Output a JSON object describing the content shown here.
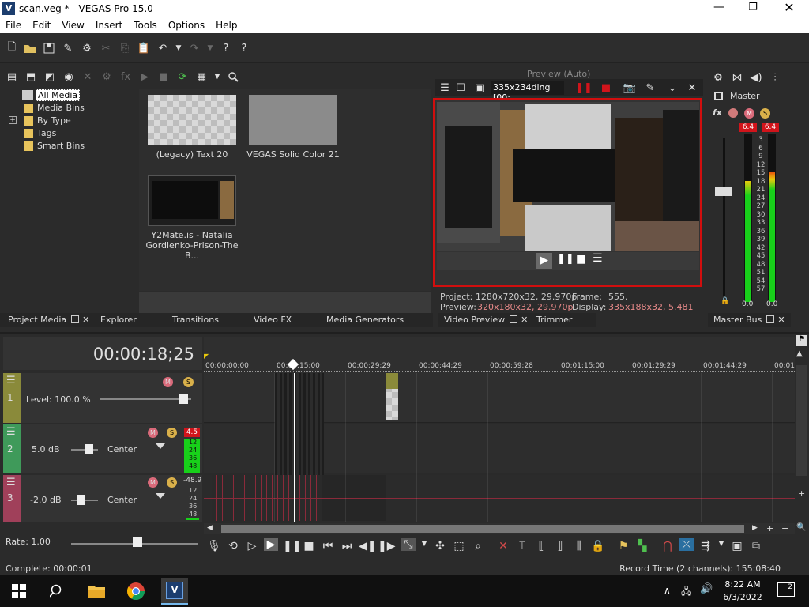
{
  "window": {
    "title": "scan.veg * - VEGAS Pro 15.0",
    "app_icon": "V"
  },
  "menu": [
    "File",
    "Edit",
    "View",
    "Insert",
    "Tools",
    "Options",
    "Help"
  ],
  "project_media": {
    "tree": [
      "All Media",
      "Media Bins",
      "By Type",
      "Tags",
      "Smart Bins"
    ],
    "items": [
      {
        "label": "(Legacy) Text 20"
      },
      {
        "label": "VEGAS Solid Color 21"
      },
      {
        "label": "Y2Mate.is - Natalia Gordienko-Prison-The B..."
      }
    ]
  },
  "bottom_tabs": [
    "Project Media",
    "Explorer",
    "Transitions",
    "Video FX",
    "Media Generators"
  ],
  "preview": {
    "toolbar_text": "Preview (Auto)",
    "position_field": "335x234ding [00:",
    "project_info": "Project:  1280x720x32, 29.970p",
    "frame_label": "Frame:",
    "frame_value": "555.",
    "preview_label": "Preview:",
    "preview_value": "320x180x32, 29.970p",
    "display_label": "Display:",
    "display_value": "335x188x32, 5.481"
  },
  "preview_tabs": [
    "Video Preview",
    "Trimmer"
  ],
  "master": {
    "title": "Master",
    "peak_left": "6.4",
    "peak_right": "6.4",
    "scale": [
      "3",
      "6",
      "9",
      "12",
      "15",
      "18",
      "21",
      "24",
      "27",
      "30",
      "33",
      "36",
      "39",
      "42",
      "45",
      "48",
      "51",
      "54",
      "57"
    ],
    "bottom_left": "0.0",
    "bottom_right": "0.0",
    "tab": "Master Bus",
    "left_level": 0.72,
    "right_level": 0.72
  },
  "timeline": {
    "timecode": "00:00:18;25",
    "ruler": [
      "00:00:00;00",
      "00:00:15;00",
      "00:00:29;29",
      "00:00:44;29",
      "00:00:59;28",
      "00:01:15;00",
      "00:01:29;29",
      "00:01:44;29",
      "00:01"
    ],
    "tracks": [
      {
        "num": "1",
        "level_label": "Level: 100.0 %"
      },
      {
        "num": "2",
        "volume": "5.0 dB",
        "pan": "Center",
        "peak": "4.5",
        "scale": [
          "12",
          "24",
          "36",
          "48"
        ]
      },
      {
        "num": "3",
        "volume": "-2.0 dB",
        "pan": "Center",
        "peak": "-48.9",
        "scale": [
          "12",
          "24",
          "36",
          "48"
        ]
      }
    ],
    "rate": "Rate: 1.00"
  },
  "status": {
    "left": "Complete: 00:00:01",
    "right": "Record Time (2 channels): 155:08:40"
  },
  "taskbar": {
    "time": "8:22 AM",
    "date": "6/3/2022",
    "notif": "2"
  },
  "colors": {
    "accent_red": "#d1141b",
    "meter_green": "#18d01a",
    "preview_border": "#d10e0e",
    "bg": "#2b2b2b"
  }
}
